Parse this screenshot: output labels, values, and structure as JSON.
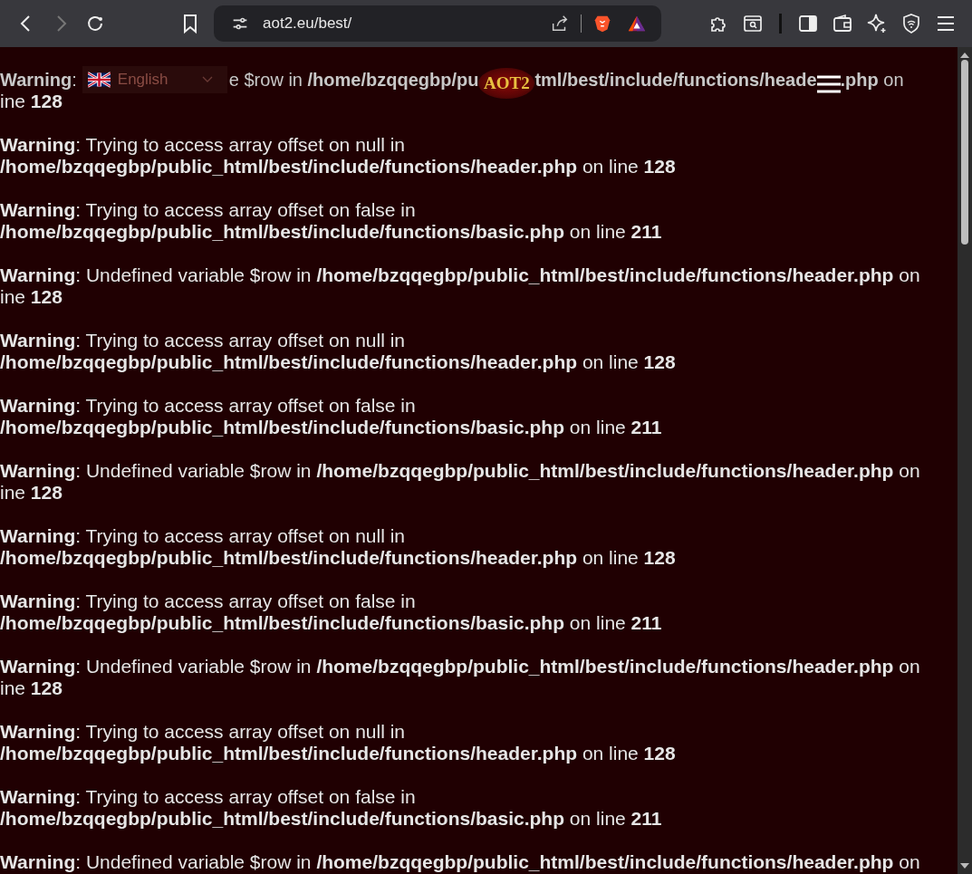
{
  "toolbar": {
    "url": "aot2.eu/best/",
    "forward_enabled": false
  },
  "site_header": {
    "language": "English",
    "logo": "AOT2"
  },
  "warnings": [
    {
      "fragments": [
        "**Warning**:",
        "e $row in **/home/bzqqegbp/pu**",
        "**tml/best/include/functions/heade**",
        "**.php** on"
      ],
      "lines": [
        "ine **128**"
      ]
    },
    {
      "lines": [
        "**Warning**: Trying to access array offset on null in",
        "**/home/bzqqegbp/public_html/best/include/functions/header.php** on line **128**"
      ]
    },
    {
      "lines": [
        "**Warning**: Trying to access array offset on false in",
        "**/home/bzqqegbp/public_html/best/include/functions/basic.php** on line **211**"
      ]
    },
    {
      "lines": [
        "**Warning**: Undefined variable $row in **/home/bzqqegbp/public_html/best/include/functions/header.php** on",
        "ine **128**"
      ]
    },
    {
      "lines": [
        "**Warning**: Trying to access array offset on null in",
        "**/home/bzqqegbp/public_html/best/include/functions/header.php** on line **128**"
      ]
    },
    {
      "lines": [
        "**Warning**: Trying to access array offset on false in",
        "**/home/bzqqegbp/public_html/best/include/functions/basic.php** on line **211**"
      ]
    },
    {
      "lines": [
        "**Warning**: Undefined variable $row in **/home/bzqqegbp/public_html/best/include/functions/header.php** on",
        "ine **128**"
      ]
    },
    {
      "lines": [
        "**Warning**: Trying to access array offset on null in",
        "**/home/bzqqegbp/public_html/best/include/functions/header.php** on line **128**"
      ]
    },
    {
      "lines": [
        "**Warning**: Trying to access array offset on false in",
        "**/home/bzqqegbp/public_html/best/include/functions/basic.php** on line **211**"
      ]
    },
    {
      "lines": [
        "**Warning**: Undefined variable $row in **/home/bzqqegbp/public_html/best/include/functions/header.php** on",
        "ine **128**"
      ]
    },
    {
      "lines": [
        "**Warning**: Trying to access array offset on null in",
        "**/home/bzqqegbp/public_html/best/include/functions/header.php** on line **128**"
      ]
    },
    {
      "lines": [
        "**Warning**: Trying to access array offset on false in",
        "**/home/bzqqegbp/public_html/best/include/functions/basic.php** on line **211**"
      ]
    },
    {
      "lines": [
        "**Warning**: Undefined variable $row in **/home/bzqqegbp/public_html/best/include/functions/header.php** on"
      ]
    }
  ]
}
